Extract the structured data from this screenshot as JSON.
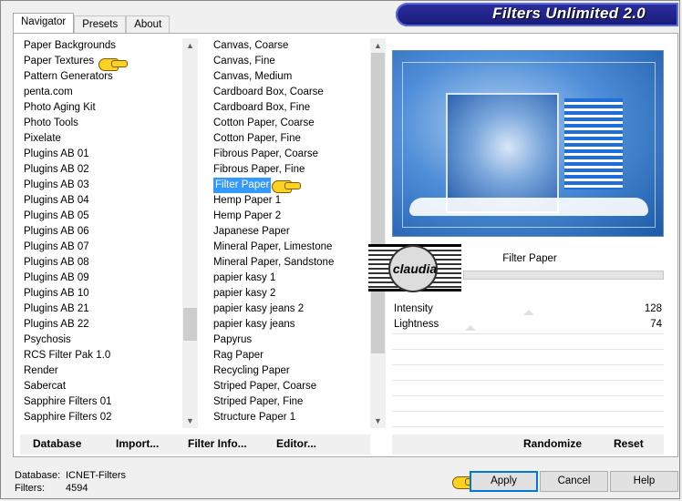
{
  "banner": {
    "title": "Filters Unlimited 2.0"
  },
  "tabs": [
    {
      "label": "Navigator"
    },
    {
      "label": "Presets"
    },
    {
      "label": "About"
    }
  ],
  "categories": [
    "Paper Backgrounds",
    "Paper Textures",
    "Pattern Generators",
    "penta.com",
    "Photo Aging Kit",
    "Photo Tools",
    "Pixelate",
    "Plugins AB 01",
    "Plugins AB 02",
    "Plugins AB 03",
    "Plugins AB 04",
    "Plugins AB 05",
    "Plugins AB 06",
    "Plugins AB 07",
    "Plugins AB 08",
    "Plugins AB 09",
    "Plugins AB 10",
    "Plugins AB 21",
    "Plugins AB 22",
    "Psychosis",
    "RCS Filter Pak 1.0",
    "Render",
    "Sabercat",
    "Sapphire Filters 01",
    "Sapphire Filters 02"
  ],
  "filters": [
    "Canvas, Coarse",
    "Canvas, Fine",
    "Canvas, Medium",
    "Cardboard Box, Coarse",
    "Cardboard Box, Fine",
    "Cotton Paper, Coarse",
    "Cotton Paper, Fine",
    "Fibrous Paper, Coarse",
    "Fibrous Paper, Fine",
    "Filter Paper",
    "Hemp Paper 1",
    "Hemp Paper 2",
    "Japanese Paper",
    "Mineral Paper, Limestone",
    "Mineral Paper, Sandstone",
    "papier kasy 1",
    "papier kasy 2",
    "papier kasy jeans 2",
    "papier kasy jeans",
    "Papyrus",
    "Rag Paper",
    "Recycling Paper",
    "Striped Paper, Coarse",
    "Striped Paper, Fine",
    "Structure Paper 1"
  ],
  "selected_category": "Paper Textures",
  "selected_filter": "Filter Paper",
  "watermark": {
    "text": "claudia"
  },
  "params": {
    "filter_name": "Filter Paper",
    "rows": [
      {
        "label": "Intensity",
        "value": "128"
      },
      {
        "label": "Lightness",
        "value": "74"
      }
    ]
  },
  "toolbar": {
    "database": "Database",
    "import": "Import...",
    "filter_info": "Filter Info...",
    "editor": "Editor...",
    "randomize": "Randomize",
    "reset": "Reset"
  },
  "status": {
    "database_label": "Database:",
    "database_value": "ICNET-Filters",
    "filters_label": "Filters:",
    "filters_value": "4594"
  },
  "buttons": {
    "apply": "Apply",
    "cancel": "Cancel",
    "help": "Help"
  },
  "colors": {
    "selection": "#3399ff",
    "banner": "#1f2290",
    "pointer": "#ffd21f"
  }
}
